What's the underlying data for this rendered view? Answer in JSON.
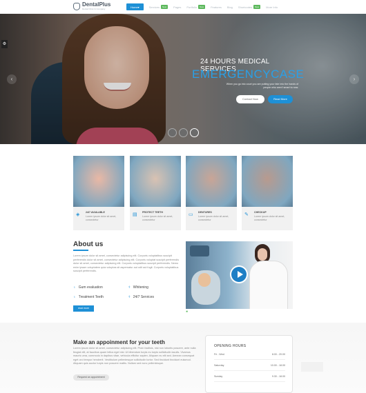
{
  "nav": {
    "logo_name": "DentalPlus",
    "logo_tagline": "Dental Clinic & Company",
    "items": [
      {
        "label": "Home",
        "active": true,
        "badge": ""
      },
      {
        "label": "Services",
        "active": false,
        "badge": "New"
      },
      {
        "label": "Pages",
        "active": false,
        "badge": ""
      },
      {
        "label": "Portfolio",
        "active": false,
        "badge": "New"
      },
      {
        "label": "Features",
        "active": false,
        "badge": ""
      },
      {
        "label": "Blog",
        "active": false,
        "badge": ""
      },
      {
        "label": "Shortcodes",
        "active": false,
        "badge": "New"
      },
      {
        "label": "More Info",
        "active": false,
        "badge": ""
      }
    ]
  },
  "hero": {
    "kicker": "24 HOURS MEDICAL SERVICES",
    "title": "EMERGENCYCASE",
    "description": "When you go into court you are putting your fate into the hands of people who aren't smart to now.",
    "contact_label": "Contact Now",
    "read_label": "Read More",
    "prev_arrow": "‹",
    "next_arrow": "›",
    "side_tab": "⚙"
  },
  "services": [
    {
      "title": "24/7 AVAILABLE",
      "icon": "shield-icon",
      "glyph": "◈",
      "text": "Lorem ipsum dolor sit amet, consectetur",
      "color": "#e9b8a5"
    },
    {
      "title": "PROTECT TEETH",
      "icon": "calendar-icon",
      "glyph": "▤",
      "text": "Lorem ipsum dolor sit amet, consectetur",
      "color": "#d9c2b2"
    },
    {
      "title": "DENTURES",
      "icon": "note-icon",
      "glyph": "▭",
      "text": "Lorem ipsum dolor sit amet, consectetur",
      "color": "#c9a596"
    },
    {
      "title": "CHECKUP",
      "icon": "pen-icon",
      "glyph": "✎",
      "text": "Lorem ipsum dolor sit amet, consectetur",
      "color": "#b89a8e"
    }
  ],
  "about": {
    "title": "About us",
    "text": "Lorem ipsum dolor sit amet, consectetur adipiscing elit. Corporis voluptatibus suscipit perferendis dolor sit amet, consectetur adipiscing elit. Corporis voluptat suscipit perferendis dolor sit amet, consectetur adipiscing elit. Corporis voluptatibus suscipit perferendis. Nemo enim ipsam voluptatem quia voluptas sit aspernatur aut odit aut fugit. Corporis voluptatibus suscipit perferendis.",
    "features": [
      {
        "label": "Gum evaluation",
        "icon": "tooth-icon",
        "glyph": "♁"
      },
      {
        "label": "Whitening",
        "icon": "brush-icon",
        "glyph": "⚕"
      },
      {
        "label": "Treatment Teeth",
        "icon": "tooth-icon",
        "glyph": "♁"
      },
      {
        "label": "24/7 Services",
        "icon": "brush-icon",
        "glyph": "⚕"
      }
    ],
    "button_label": "read more"
  },
  "video": {
    "tag": "❀"
  },
  "appointment": {
    "title": "Make an appoinment for your teeth",
    "text": "Lorem ipsum dolor sit amet, consectetur adipiscing elit. Proin facilisis, nisi non lobortis posuere, ante nulla feugiat elit, at faucibus quam tellus eget nisi. Ut bibendum turpis eu turpis sollicitudin iaculis. Vivamus mauris urna, commodo in dapibus vitae, vehicula efficitur sapien. Aliquam eu elit sed. Aenean consequat eget orci tempor hendrerit. Vestibulum pellentesque sollicitudin tortor. Sed tincidunt tincidunt euismod. Aliquam quis auctor turpis non posuere mattis. Nullam sed nunc pellentesque.",
    "button_label": "Request an appointment"
  },
  "hours": {
    "title": "OPENING HOURS",
    "rows": [
      {
        "day": "Fri - Wed",
        "time": "8.00 - 20.00"
      },
      {
        "day": "Saturday",
        "time": "10.00 - 18.00"
      },
      {
        "day": "Sunday",
        "time": "9.30 - 18.00"
      }
    ]
  },
  "colors": {
    "accent": "#1e90d6",
    "badge": "#5cb85c"
  }
}
